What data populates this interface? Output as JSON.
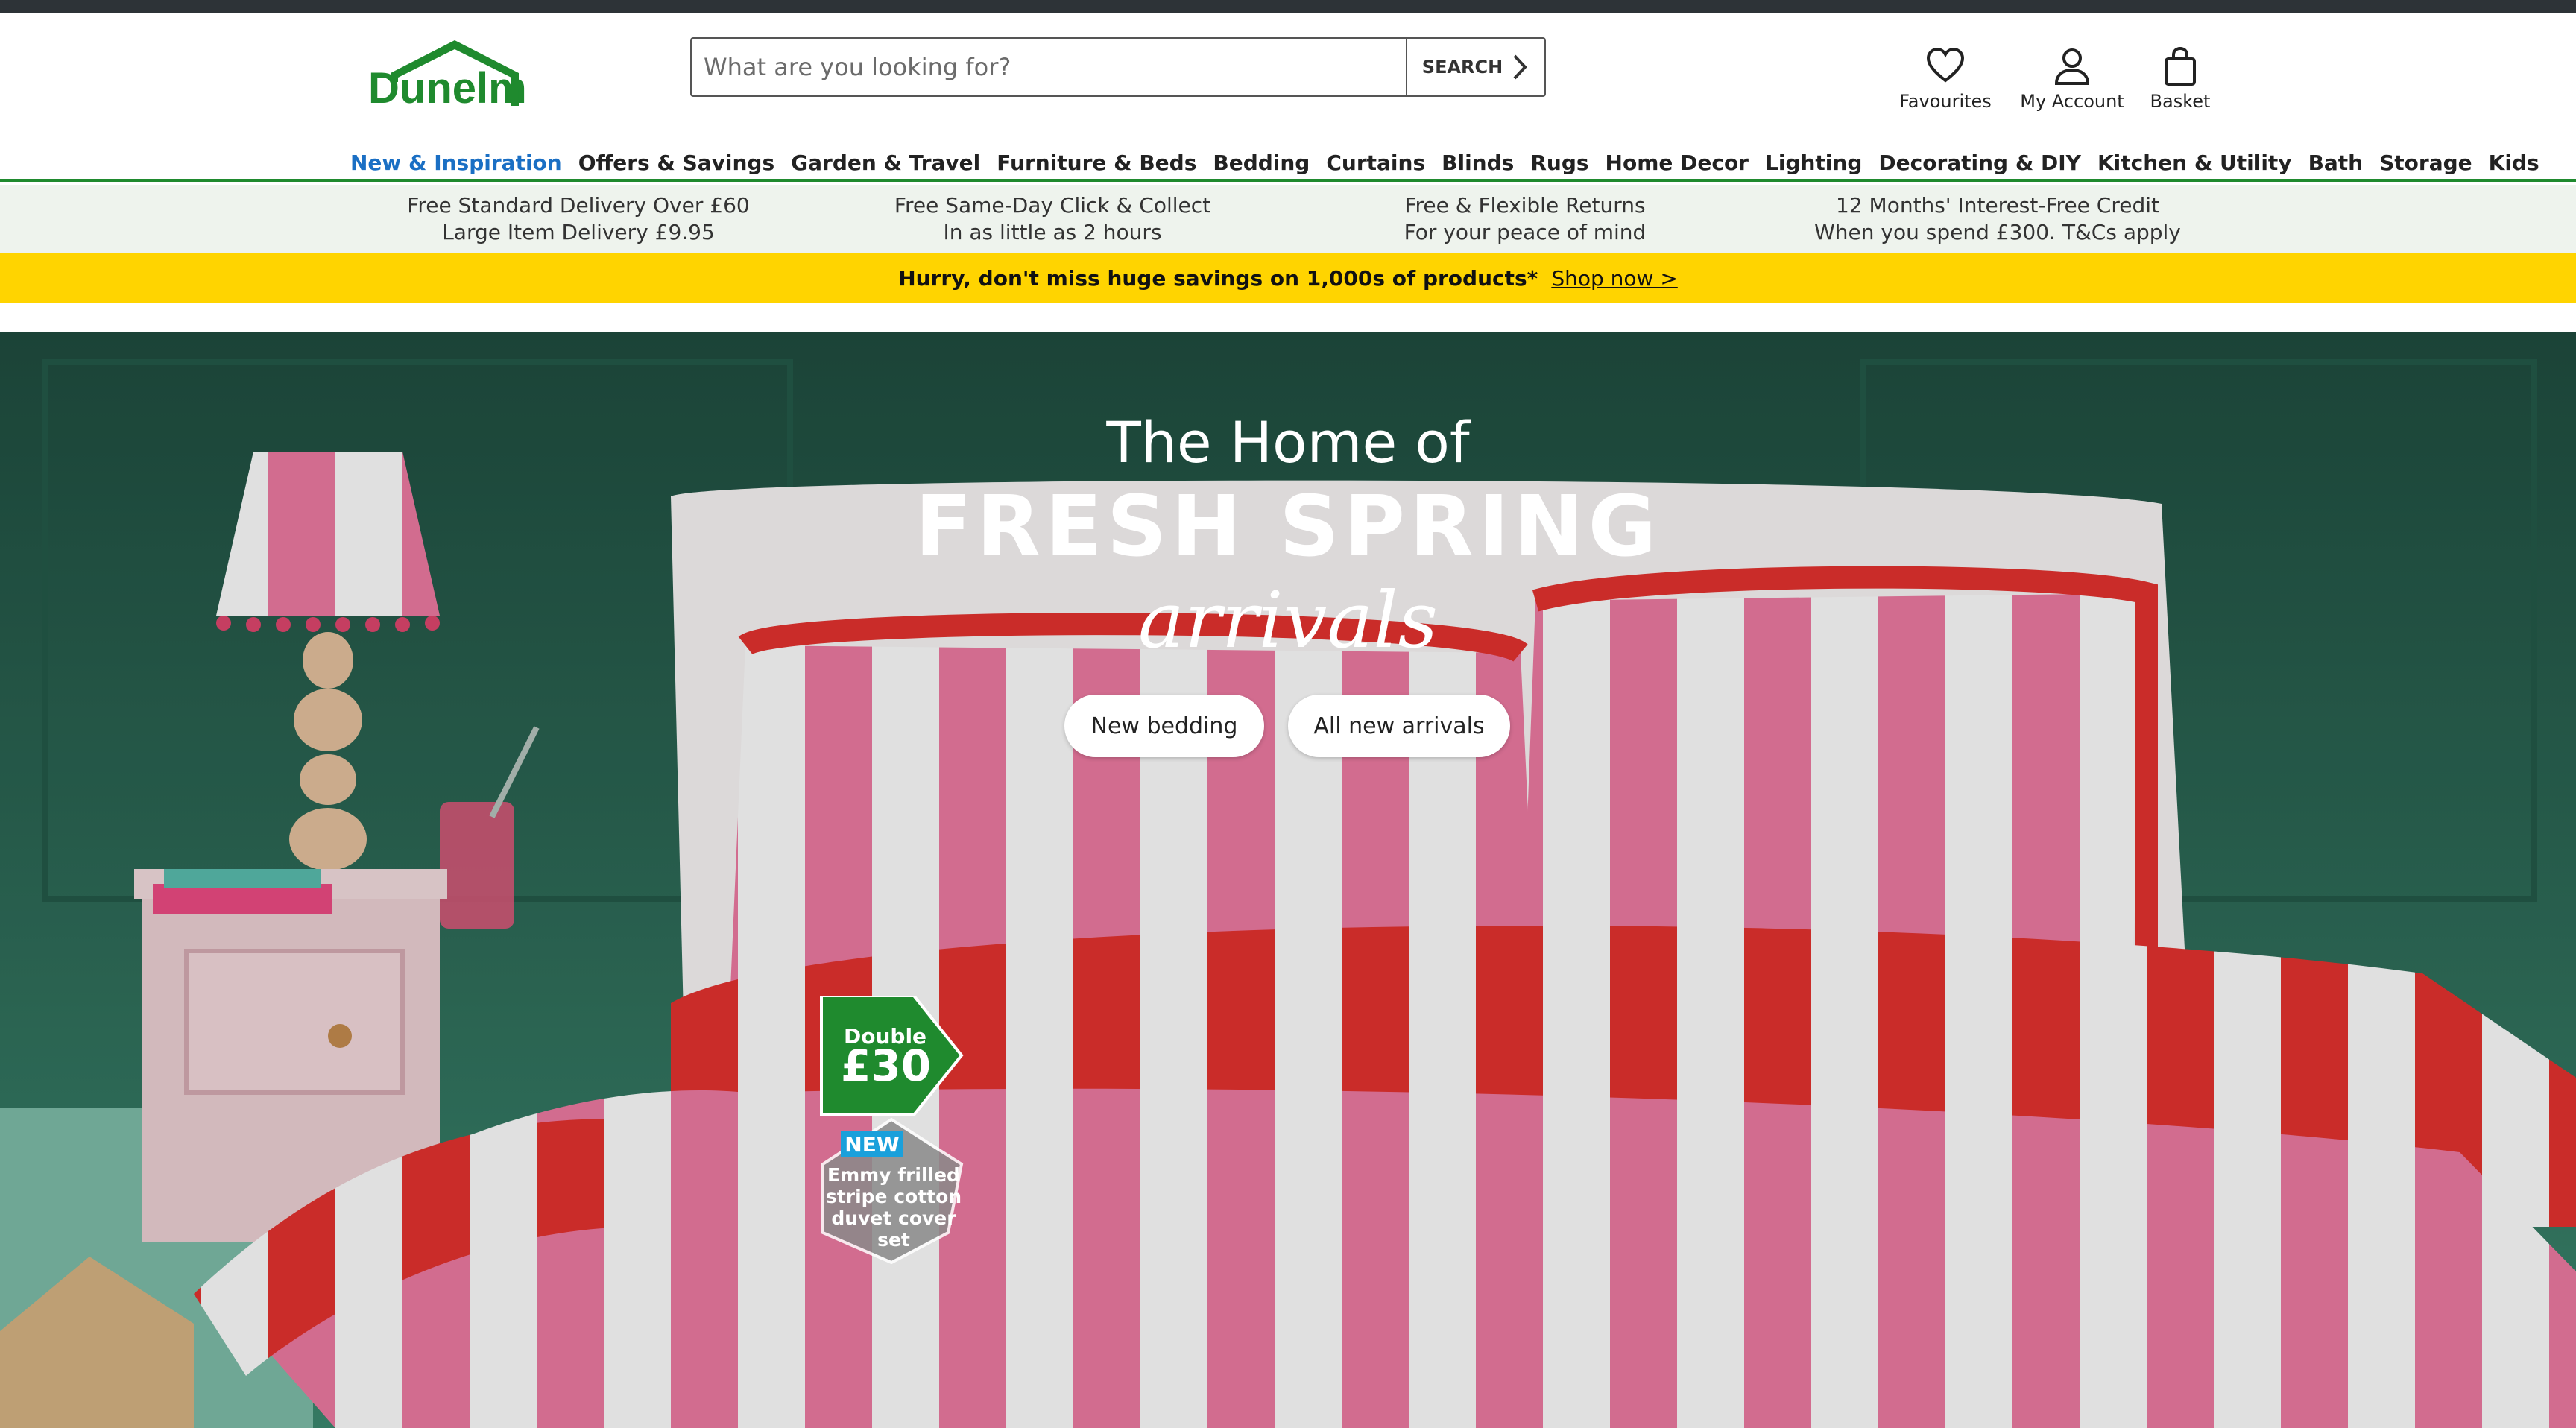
{
  "header": {
    "logo_text": "Dunelm",
    "search": {
      "placeholder": "What are you looking for?",
      "button_label": "SEARCH"
    },
    "icons": [
      {
        "label": "Favourites",
        "icon": "heart-icon"
      },
      {
        "label": "My Account",
        "icon": "user-icon"
      },
      {
        "label": "Basket",
        "icon": "basket-icon"
      }
    ]
  },
  "nav": {
    "items": [
      "New & Inspiration",
      "Offers & Savings",
      "Garden & Travel",
      "Furniture & Beds",
      "Bedding",
      "Curtains",
      "Blinds",
      "Rugs",
      "Home Decor",
      "Lighting",
      "Decorating & DIY",
      "Kitchen & Utility",
      "Bath",
      "Storage",
      "Kids"
    ],
    "active_index": 0
  },
  "usps": [
    {
      "line1": "Free Standard Delivery Over £60",
      "line2": "Large Item Delivery £9.95"
    },
    {
      "line1": "Free Same-Day Click & Collect",
      "line2": "In as little as 2 hours"
    },
    {
      "line1": "Free & Flexible Returns",
      "line2": "For your peace of mind"
    },
    {
      "line1": "12 Months' Interest-Free Credit",
      "line2": "When you spend £300. T&Cs apply"
    }
  ],
  "promo": {
    "text": "Hurry, don't miss huge savings on 1,000s of products*",
    "link": "Shop now >"
  },
  "hero": {
    "line1": "The Home of",
    "line2": "FRESH SPRING",
    "line3": "arrivals",
    "buttons": [
      "New bedding",
      "All new arrivals"
    ],
    "badge": {
      "size": "Double",
      "price": "£30",
      "tag": "NEW",
      "description": "Emmy frilled stripe cotton duvet cover set"
    }
  },
  "colors": {
    "brand_green": "#1f8a2e",
    "topbar": "#2d3337",
    "promo_yellow": "#ffd400",
    "nav_active": "#1a6fc4",
    "usp_bg": "#eef3ed"
  }
}
